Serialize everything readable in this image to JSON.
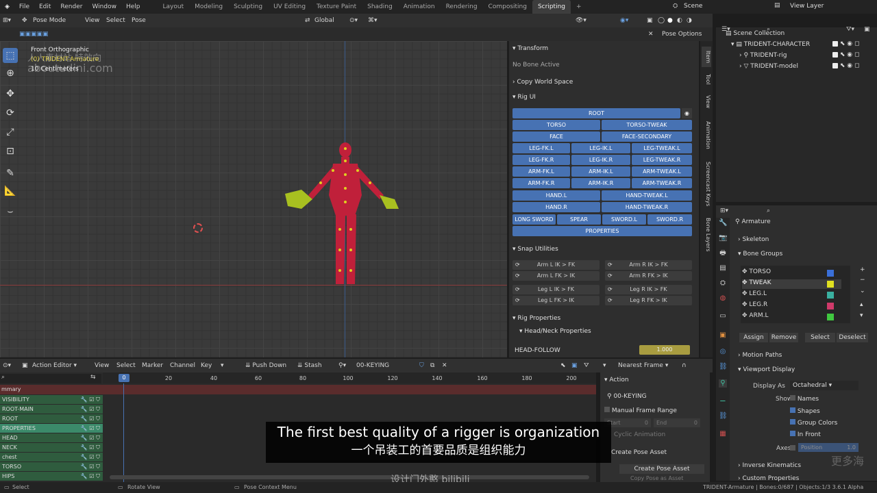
{
  "topbar": {
    "menus": [
      "File",
      "Edit",
      "Render",
      "Window",
      "Help"
    ],
    "workspaces": [
      "Layout",
      "Modeling",
      "Sculpting",
      "UV Editing",
      "Texture Paint",
      "Shading",
      "Animation",
      "Rendering",
      "Compositing",
      "Scripting"
    ],
    "active_workspace": "Scripting",
    "scene": "Scene",
    "view_layer": "View Layer"
  },
  "viewport_header": {
    "mode": "Pose Mode",
    "menus": [
      "View",
      "Select",
      "Pose"
    ],
    "transform": "Global",
    "pose_options": "Pose Options"
  },
  "viewport": {
    "view_name": "Front Orthographic",
    "object_name": "(0) TRIDENT-Armature",
    "scale": "10 Centimeters"
  },
  "npanel": {
    "transform_label": "Transform",
    "no_bone": "No Bone Active",
    "copy_world": "Copy World Space",
    "rig_ui_label": "Rig UI",
    "rig_buttons": {
      "root": "ROOT",
      "torso": "TORSO",
      "torso_tweak": "TORSO-TWEAK",
      "face": "FACE",
      "face_secondary": "FACE-SECONDARY",
      "leg_fk_l": "LEG-FK.L",
      "leg_ik_l": "LEG-IK.L",
      "leg_tweak_l": "LEG-TWEAK.L",
      "leg_fk_r": "LEG-FK.R",
      "leg_ik_r": "LEG-IK.R",
      "leg_tweak_r": "LEG-TWEAK.R",
      "arm_fk_l": "ARM-FK.L",
      "arm_ik_l": "ARM-IK.L",
      "arm_tweak_l": "ARM-TWEAK.L",
      "arm_fk_r": "ARM-FK.R",
      "arm_ik_r": "ARM-IK.R",
      "arm_tweak_r": "ARM-TWEAK.R",
      "hand_l": "HAND.L",
      "hand_tweak_l": "HAND-TWEAK.L",
      "hand_r": "HAND.R",
      "hand_tweak_r": "HAND-TWEAK.R",
      "long_sword": "LONG SWORD",
      "spear": "SPEAR",
      "sword_l": "SWORD.L",
      "sword_r": "SWORD.R",
      "properties": "PROPERTIES"
    },
    "snap_label": "Snap Utilities",
    "snap": {
      "arm_l_ik_fk": "Arm L IK > FK",
      "arm_r_ik_fk": "Arm R IK > FK",
      "arm_l_fk_ik": "Arm L FK > IK",
      "arm_r_fk_ik": "Arm R FK > IK",
      "leg_l_ik_fk": "Leg L IK > FK",
      "leg_r_ik_fk": "Leg R IK > FK",
      "leg_l_fk_ik": "Leg L FK > IK",
      "leg_r_fk_ik": "Leg R FK > IK"
    },
    "rig_props_label": "Rig Properties",
    "head_neck_label": "Head/Neck Properties",
    "head_follow_label": "HEAD-FOLLOW",
    "head_follow_value": "1.000"
  },
  "ntabs": [
    "Item",
    "Tool",
    "View",
    "Animation",
    "Screencast Keys",
    "Bone Layers"
  ],
  "outliner": {
    "root": "Scene Collection",
    "collection": "TRIDENT-CHARACTER",
    "items": [
      "TRIDENT-rig",
      "TRIDENT-model"
    ]
  },
  "properties": {
    "armature": "Armature",
    "skeleton": "Skeleton",
    "bone_groups": "Bone Groups",
    "groups": [
      {
        "name": "TORSO",
        "color": "#3a6fd8"
      },
      {
        "name": "TWEAK",
        "color": "#e0e020"
      },
      {
        "name": "LEG.L",
        "color": "#3ab0a0"
      },
      {
        "name": "LEG.R",
        "color": "#d03a6a"
      },
      {
        "name": "ARM.L",
        "color": "#40c840"
      }
    ],
    "actions": [
      "Assign",
      "Remove",
      "Select",
      "Deselect"
    ],
    "motion_paths": "Motion Paths",
    "viewport_display": "Viewport Display",
    "display_as_label": "Display As",
    "display_as_value": "Octahedral",
    "show_label": "Show",
    "show_names": "Names",
    "show_shapes": "Shapes",
    "show_group_colors": "Group Colors",
    "show_in_front": "In Front",
    "axes_label": "Axes",
    "axes_position_label": "Position",
    "axes_position_value": "1.0",
    "inverse_kinematics": "Inverse Kinematics",
    "custom_properties": "Custom Properties"
  },
  "action_editor": {
    "mode": "Action Editor",
    "menus": [
      "View",
      "Select",
      "Marker",
      "Channel",
      "Key"
    ],
    "push_down": "Push Down",
    "stash": "Stash",
    "action_name": "00-KEYING",
    "snapping": "Nearest Frame",
    "current_frame": "0",
    "ticks": [
      "20",
      "40",
      "60",
      "80",
      "100",
      "120",
      "140",
      "160",
      "180",
      "200"
    ],
    "summary": "mmary",
    "channels": [
      "VISIBILITY",
      "ROOT-MAIN",
      "ROOT",
      "PROPERTIES",
      "HEAD",
      "NECK",
      "chest",
      "TORSO",
      "HIPS"
    ],
    "side_action": "Action",
    "side_action_name": "00-KEYING",
    "manual_range": "Manual Frame Range",
    "start_label": "Start",
    "start_value": "0",
    "end_label": "End",
    "end_value": "0",
    "cyclic": "Cyclic Animation",
    "create_pose_asset_header": "Create Pose Asset",
    "create_pose_asset_btn": "Create Pose Asset",
    "copy_pose_as_asset": "Copy Pose as Asset"
  },
  "statusbar": {
    "select": "Select",
    "rotate": "Rotate View",
    "context": "Pose Context Menu",
    "stats": "TRIDENT-Armature | Bones:0/687 | Objects:1/3 3.6.1 Alpha"
  },
  "subtitle": {
    "en": "The first best quality of a rigger is organization",
    "zh": "一个吊装工的首要品质是组织能力"
  },
  "watermarks": {
    "top_left_cn": "人人素材站  特效向",
    "top_left_en": "aboutudini.com",
    "bottom_center": "设计门外憨 bilibili",
    "bottom_right": "更多海"
  }
}
